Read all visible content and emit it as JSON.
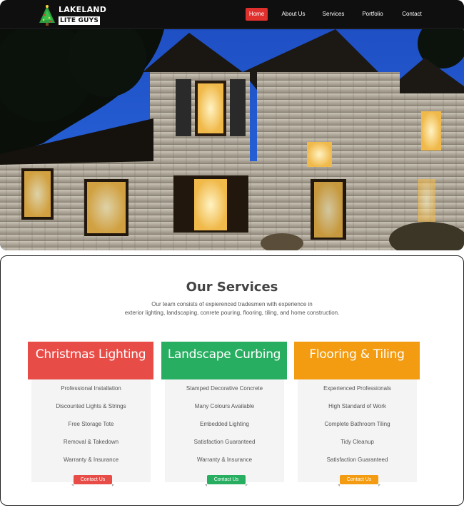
{
  "brand": {
    "line1": "LAKELAND",
    "line2": "LITE GUYS",
    "logo_icon": "christmas-tree-icon"
  },
  "nav": {
    "items": [
      "Home",
      "About Us",
      "Services",
      "Portfolio",
      "Contact"
    ],
    "active": "Home"
  },
  "hero": {
    "image": "illuminated-stone-house-at-night"
  },
  "services": {
    "title": "Our Services",
    "intro_line1": "Our team consists of expierenced tradesmen with experience in",
    "intro_line2": "exterior lighting, landscaping, conrete pouring, flooring, tiling, and home construction.",
    "cards": [
      {
        "title": "Christmas Lighting",
        "color": "#e84c47",
        "features": [
          "Professional Installation",
          "Discounted Lights & Strings",
          "Free Storage Tote",
          "Removal & Takedown",
          "Warranty & Insurance"
        ],
        "button": "Contact Us"
      },
      {
        "title": "Landscape Curbing",
        "color": "#27ae60",
        "features": [
          "Stamped Decorative Concrete",
          "Many Colours Available",
          "Embedded Lighting",
          "Satisfaction Guaranteed",
          "Warranty & Insurance"
        ],
        "button": "Contact Us"
      },
      {
        "title": "Flooring & Tiling",
        "color": "#f39c12",
        "features": [
          "Experienced Professionals",
          "High Standard of Work",
          "Complete Bathroom Tiling",
          "Tidy Cleanup",
          "Satisfaction Guaranteed"
        ],
        "button": "Contact Us"
      }
    ]
  }
}
